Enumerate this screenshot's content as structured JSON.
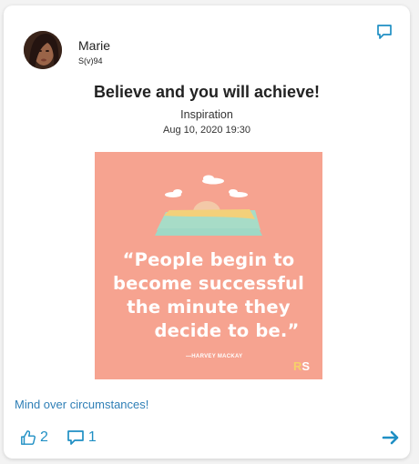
{
  "post": {
    "author": {
      "name": "Marie",
      "handle": "S(v)94"
    },
    "title": "Believe and you will achieve!",
    "category": "Inspiration",
    "date": "Aug 10, 2020 19:30",
    "image": {
      "background": "#f6a390",
      "quote_lines": [
        "“People begin to",
        "become successful",
        "the minute they",
        "decide to be.”"
      ],
      "quote_author": "—HARVEY MACKAY",
      "logo": {
        "r": "R",
        "s": "S"
      }
    },
    "caption": "Mind over circumstances!",
    "likes": "2",
    "comments": "1"
  },
  "icons": {
    "top_right": "comment-icon",
    "like": "thumbs-up-icon",
    "comment": "comment-icon",
    "next": "arrow-right-icon"
  },
  "colors": {
    "accent": "#1f8fc4",
    "caption": "#2f7fb6",
    "image_bg": "#f6a390"
  }
}
